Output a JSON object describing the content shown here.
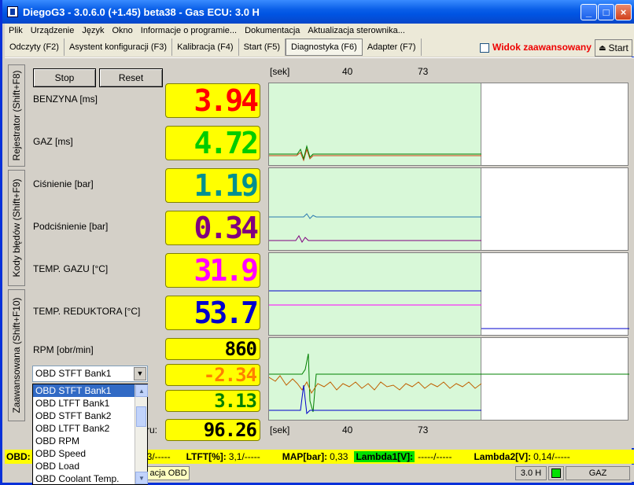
{
  "window": {
    "title": "DiegoG3 - 3.0.6.0 (+1.45) beta38 - Gas ECU: 3.0 H"
  },
  "menu": [
    "Plik",
    "Urządzenie",
    "Język",
    "Okno",
    "Informacje o programie...",
    "Dokumentacja",
    "Aktualizacja sterownika..."
  ],
  "tabs": [
    "Odczyty (F2)",
    "Asystent konfiguracji (F3)",
    "Kalibracja (F4)",
    "Start (F5)",
    "Diagnostyka (F6)",
    "Adapter (F7)"
  ],
  "active_tab": "Diagnostyka (F6)",
  "advanced": {
    "label": "Widok zaawansowany",
    "checked": false
  },
  "start_button": "Start",
  "side_tabs": [
    "Rejestrator (Shift+F8)",
    "Kody błędów (Shift+F9)",
    "Zaawansowana (Shift+F10)"
  ],
  "buttons": {
    "stop": "Stop",
    "reset": "Reset"
  },
  "params": [
    {
      "label": "BENZYNA [ms]",
      "value": "3.94",
      "color": "#ff0000"
    },
    {
      "label": "GAZ [ms]",
      "value": "4.72",
      "color": "#00cc00"
    },
    {
      "label": "Ciśnienie [bar]",
      "value": "1.19",
      "color": "#009090"
    },
    {
      "label": "Podciśnienie [bar]",
      "value": "0.34",
      "color": "#800080"
    },
    {
      "label": "TEMP. GAZU [°C]",
      "value": "31.9",
      "color": "#ff00ff"
    },
    {
      "label": "TEMP. REDUKTORA [°C]",
      "value": "53.7",
      "color": "#0000cc"
    },
    {
      "label": "RPM [obr/min]",
      "value": "860",
      "color": "#000000"
    }
  ],
  "obd_values": [
    {
      "value": "-2.34",
      "color": "#ff8000"
    },
    {
      "value": "3.13",
      "color": "#008000"
    },
    {
      "value": "96.26",
      "color": "#000000"
    }
  ],
  "hidden_label_tail": "ru:",
  "axis": {
    "unit": "[sek]",
    "ticks": [
      "40",
      "73"
    ]
  },
  "combo": {
    "selected": "OBD STFT Bank1"
  },
  "dropdown_options": [
    "OBD STFT Bank1",
    "OBD LTFT Bank1",
    "OBD STFT Bank2",
    "OBD LTFT Bank2",
    "OBD RPM",
    "OBD Speed",
    "OBD Load",
    "OBD Coolant Temp."
  ],
  "status_line": {
    "obd": "OBD:",
    "stft_tail": "3/-----",
    "ltft_label": "LTFT[%]:",
    "ltft_value": "3,1/-----",
    "map_label": "MAP[bar]:",
    "map_value": "0,33",
    "lambda1_label": "Lambda1[V]:",
    "lambda1_value": "-----/-----",
    "lambda2_label": "Lambda2[V]:",
    "lambda2_value": "0,14/-----",
    "lambda1_bg": "#00e000"
  },
  "statusbar": {
    "obd_btn_tail": "acja OBD",
    "ecu": "3.0 H",
    "fuel": "GAZ"
  }
}
